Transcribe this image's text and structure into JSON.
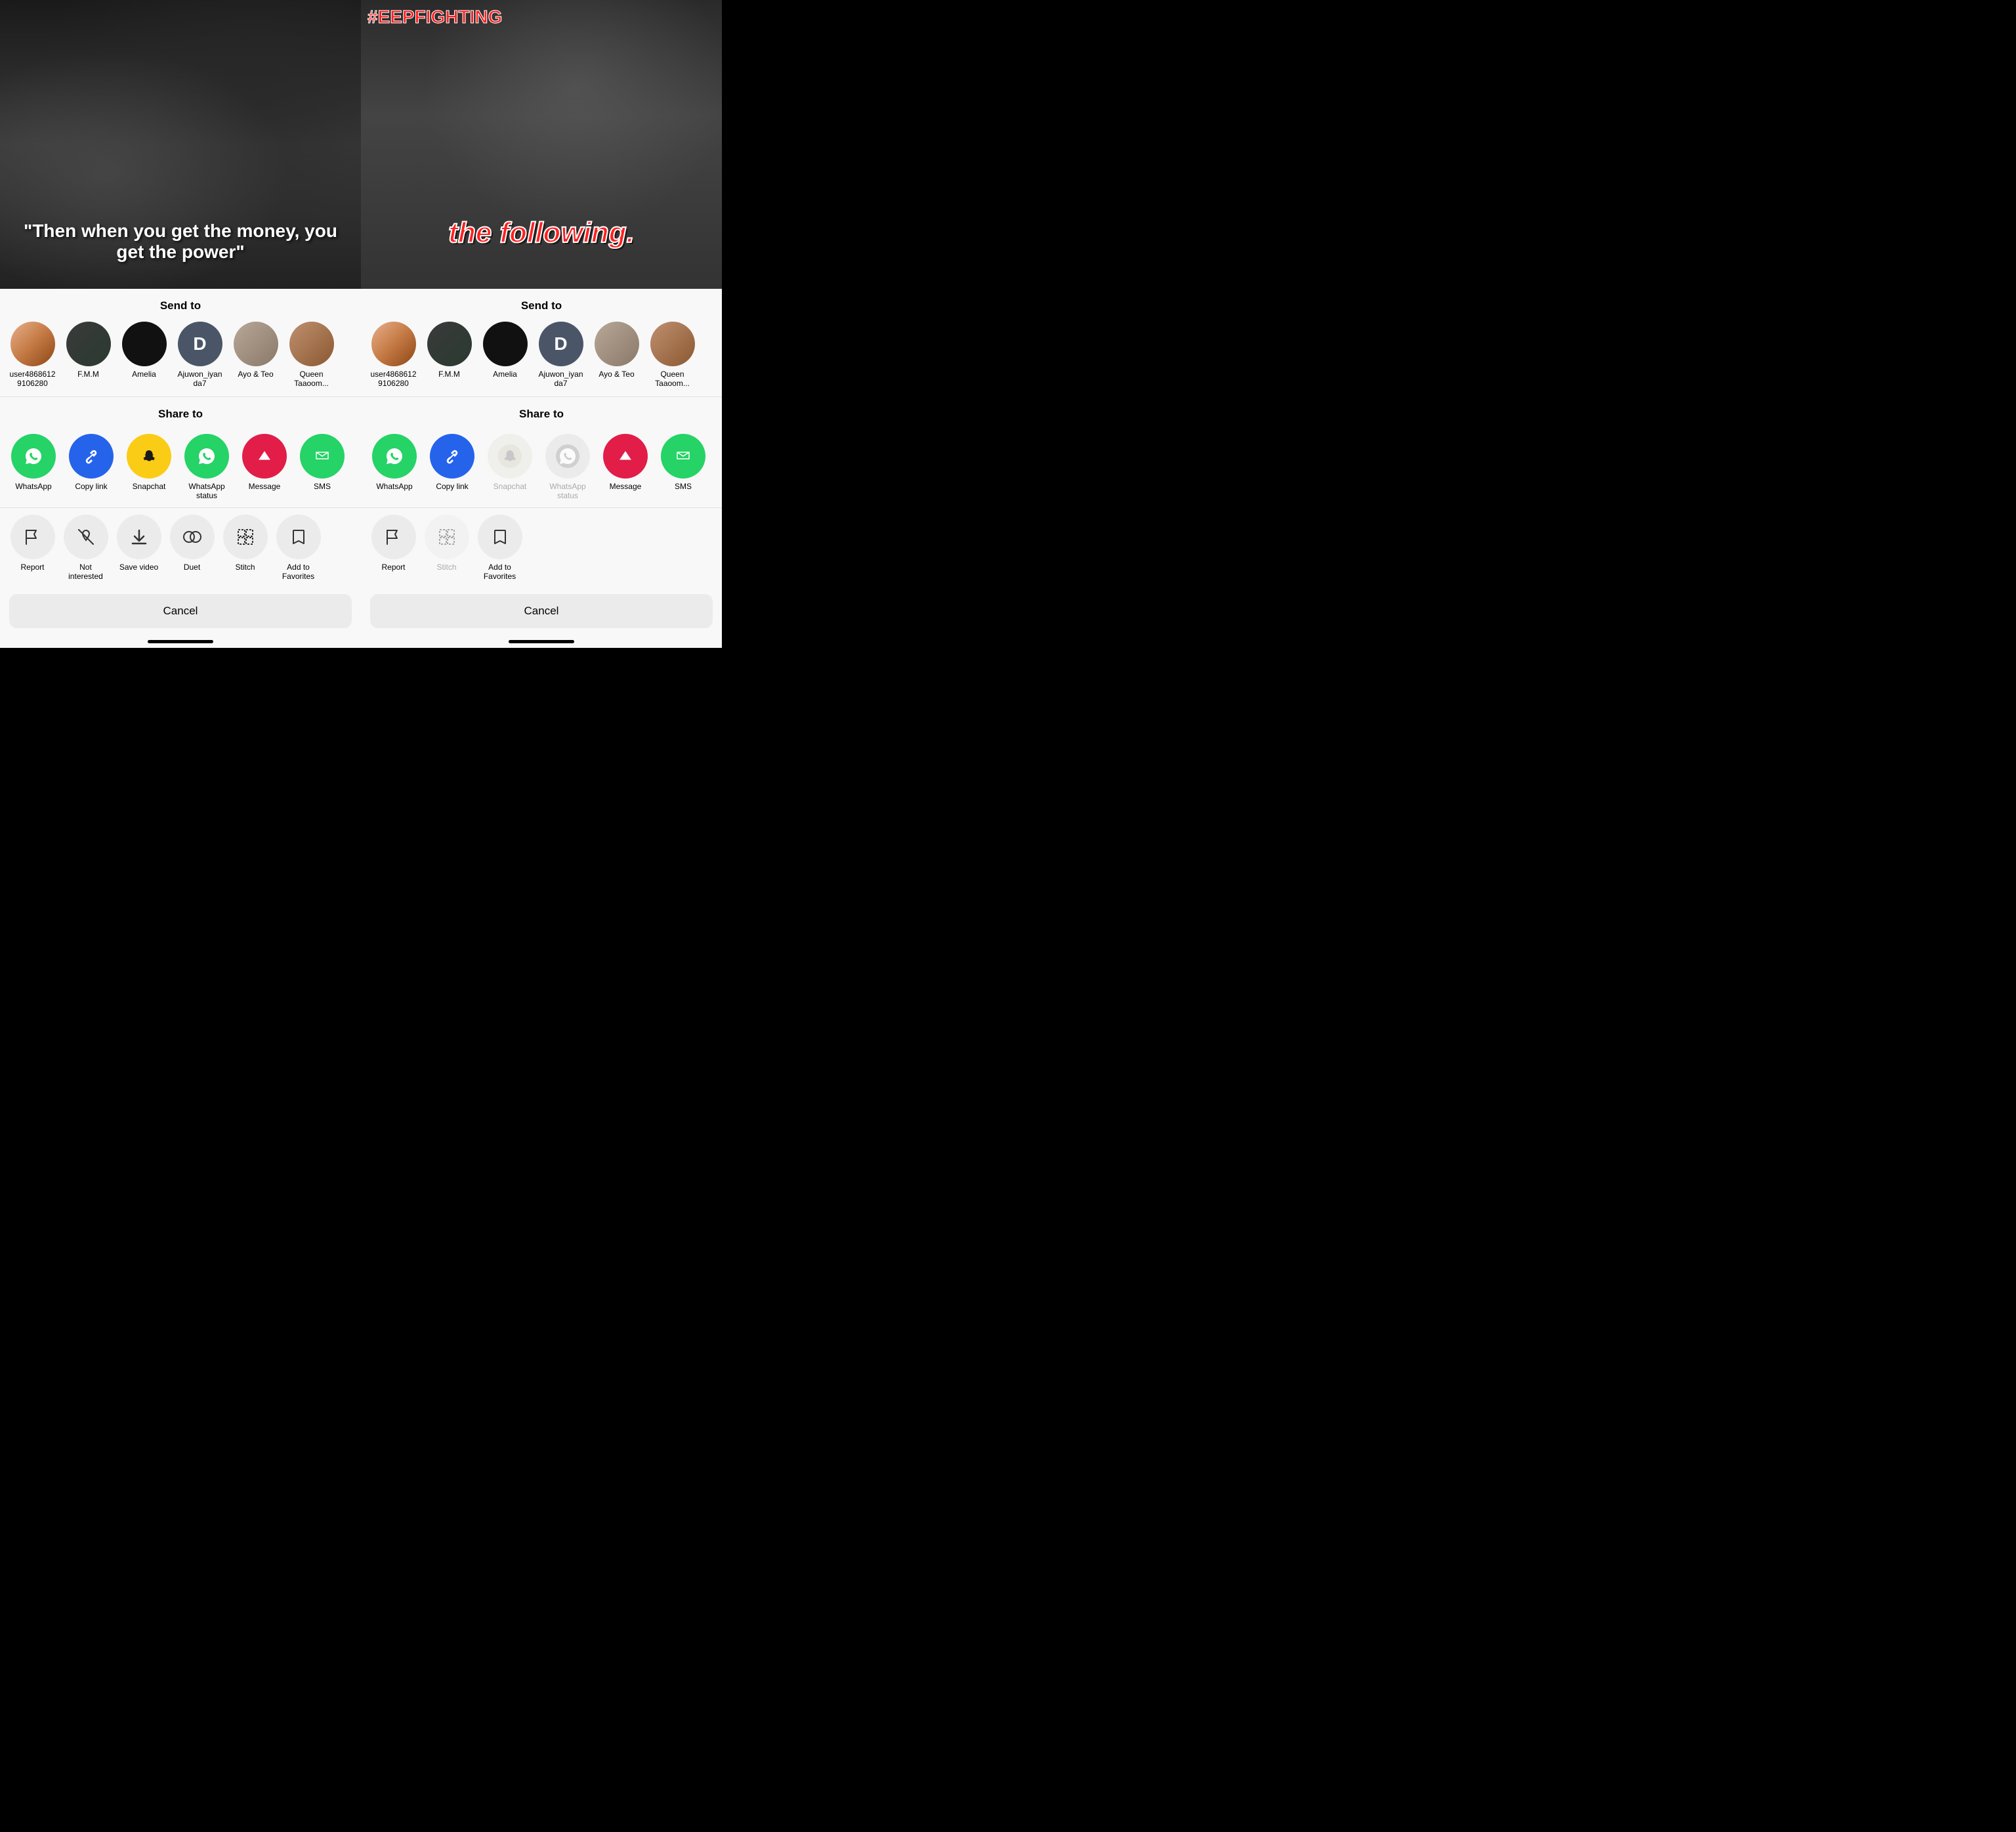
{
  "left": {
    "video_text": "\"Then when you get the money, you get the power\"",
    "send_to_title": "Send to",
    "share_to_title": "Share to",
    "contacts": [
      {
        "id": "user486886129106280",
        "name": "user4868612\n9106280",
        "color": "av-orange",
        "initials": ""
      },
      {
        "id": "fmm",
        "name": "F.M.M",
        "color": "av-dark",
        "initials": ""
      },
      {
        "id": "amelia",
        "name": "Amelia",
        "color": "av-black",
        "initials": ""
      },
      {
        "id": "ajuwon",
        "name": "Ajuwon_iyan\nda7",
        "color": "av-slate",
        "initials": "D"
      },
      {
        "id": "ayoteo",
        "name": "Ayo & Teo",
        "color": "av-photo",
        "initials": ""
      },
      {
        "id": "queen",
        "name": "Queen\nTaaoom...",
        "color": "av-brown",
        "initials": ""
      }
    ],
    "share_apps": [
      {
        "id": "whatsapp",
        "label": "WhatsApp",
        "bg": "#25d366",
        "icon": "💬",
        "disabled": false
      },
      {
        "id": "copylink",
        "label": "Copy link",
        "bg": "#2563eb",
        "icon": "🔗",
        "disabled": false
      },
      {
        "id": "snapchat",
        "label": "Snapchat",
        "bg": "#facc15",
        "icon": "👻",
        "disabled": false
      },
      {
        "id": "whatsapp-status",
        "label": "WhatsApp\nstatus",
        "bg": "#25d366",
        "icon": "💬",
        "disabled": false
      },
      {
        "id": "message",
        "label": "Message",
        "bg": "#e11d48",
        "icon": "▽",
        "disabled": false
      },
      {
        "id": "sms",
        "label": "SMS",
        "bg": "#25d366",
        "icon": "💬",
        "disabled": false
      }
    ],
    "actions": [
      {
        "id": "report",
        "label": "Report",
        "icon": "⚑",
        "disabled": false
      },
      {
        "id": "not-interested",
        "label": "Not\ninterested",
        "icon": "🤍",
        "disabled": false
      },
      {
        "id": "save-video",
        "label": "Save video",
        "icon": "⬇",
        "disabled": false
      },
      {
        "id": "duet",
        "label": "Duet",
        "icon": "◎",
        "disabled": false
      },
      {
        "id": "stitch",
        "label": "Stitch",
        "icon": "⊞",
        "disabled": false
      },
      {
        "id": "add-to-favorites",
        "label": "Add to\nFavorites",
        "icon": "🔖",
        "disabled": false
      }
    ],
    "cancel_label": "Cancel"
  },
  "right": {
    "hashtag": "#EEPFIGHTING",
    "video_text": "the following.",
    "send_to_title": "Send to",
    "share_to_title": "Share to",
    "contacts": [
      {
        "id": "user486886129106280",
        "name": "user4868612\n9106280",
        "color": "av-orange",
        "initials": ""
      },
      {
        "id": "fmm",
        "name": "F.M.M",
        "color": "av-dark",
        "initials": ""
      },
      {
        "id": "amelia",
        "name": "Amelia",
        "color": "av-black",
        "initials": ""
      },
      {
        "id": "ajuwon",
        "name": "Ajuwon_iyan\nda7",
        "color": "av-slate",
        "initials": "D"
      },
      {
        "id": "ayoteo",
        "name": "Ayo & Teo",
        "color": "av-photo",
        "initials": ""
      },
      {
        "id": "queen",
        "name": "Queen\nTaaoom...",
        "color": "av-brown",
        "initials": ""
      }
    ],
    "share_apps": [
      {
        "id": "whatsapp",
        "label": "WhatsApp",
        "bg": "#25d366",
        "icon": "💬",
        "disabled": false
      },
      {
        "id": "copylink",
        "label": "Copy link",
        "bg": "#2563eb",
        "icon": "🔗",
        "disabled": false
      },
      {
        "id": "snapchat",
        "label": "Snapchat",
        "bg": "#e5e5e5",
        "icon": "👻",
        "disabled": true
      },
      {
        "id": "whatsapp-status",
        "label": "WhatsApp\nstatus",
        "bg": "#e5e5e5",
        "icon": "💬",
        "disabled": true
      },
      {
        "id": "message",
        "label": "Message",
        "bg": "#e11d48",
        "icon": "▽",
        "disabled": false
      },
      {
        "id": "sms",
        "label": "SMS",
        "bg": "#25d366",
        "icon": "💬",
        "disabled": false
      }
    ],
    "actions": [
      {
        "id": "report",
        "label": "Report",
        "icon": "⚑",
        "disabled": false
      },
      {
        "id": "stitch",
        "label": "Stitch",
        "icon": "⊞",
        "disabled": true
      },
      {
        "id": "add-to-favorites",
        "label": "Add to\nFavorites",
        "icon": "🔖",
        "disabled": false
      }
    ],
    "cancel_label": "Cancel"
  }
}
